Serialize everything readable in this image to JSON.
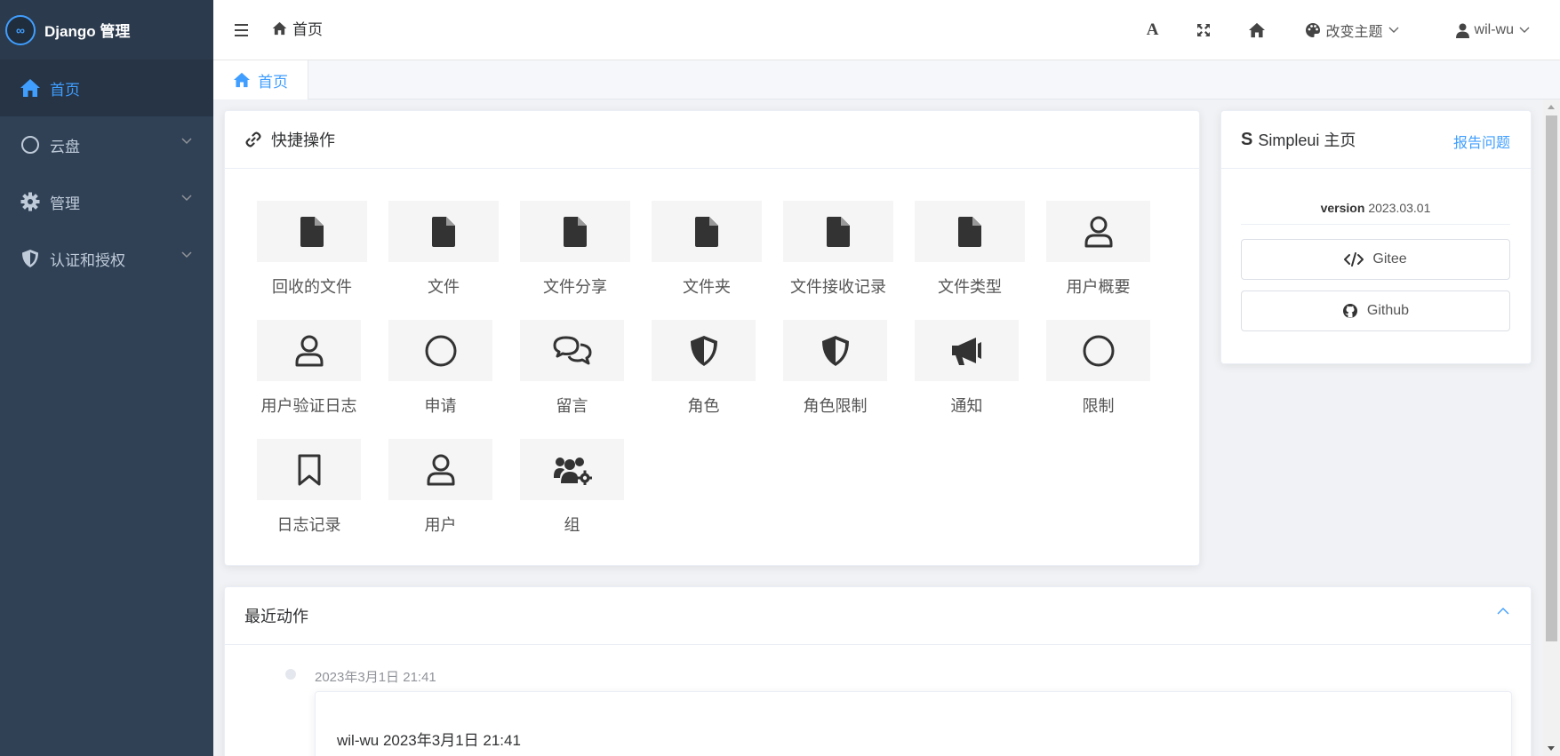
{
  "app": {
    "title": "Django 管理",
    "logo_glyph": "∞"
  },
  "sidebar": {
    "items": [
      {
        "label": "首页",
        "icon": "home-icon",
        "active": true
      },
      {
        "label": "云盘",
        "icon": "circle-icon"
      },
      {
        "label": "管理",
        "icon": "gear-icon"
      },
      {
        "label": "认证和授权",
        "icon": "shield-icon"
      }
    ]
  },
  "header": {
    "breadcrumb": "首页",
    "theme_label": "改变主题",
    "user_label": "wil-wu",
    "font_icon_glyph": "A"
  },
  "tabs": [
    {
      "label": "首页"
    }
  ],
  "quick": {
    "title": "快捷操作",
    "items": [
      {
        "label": "回收的文件",
        "icon": "file-icon"
      },
      {
        "label": "文件",
        "icon": "file-icon"
      },
      {
        "label": "文件分享",
        "icon": "file-icon"
      },
      {
        "label": "文件夹",
        "icon": "file-icon"
      },
      {
        "label": "文件接收记录",
        "icon": "file-icon"
      },
      {
        "label": "文件类型",
        "icon": "file-icon"
      },
      {
        "label": "用户概要",
        "icon": "user-icon"
      },
      {
        "label": "用户验证日志",
        "icon": "user-icon"
      },
      {
        "label": "申请",
        "icon": "circle-icon"
      },
      {
        "label": "留言",
        "icon": "comments-icon"
      },
      {
        "label": "角色",
        "icon": "shield-icon"
      },
      {
        "label": "角色限制",
        "icon": "shield-icon"
      },
      {
        "label": "通知",
        "icon": "megaphone-icon"
      },
      {
        "label": "限制",
        "icon": "circle-icon"
      },
      {
        "label": "日志记录",
        "icon": "bookmark-icon"
      },
      {
        "label": "用户",
        "icon": "user-icon"
      },
      {
        "label": "组",
        "icon": "users-gear-icon"
      }
    ]
  },
  "simpleui": {
    "logo_glyph": "S",
    "title": "Simpleui 主页",
    "report_label": "报告问题",
    "version_label": "version",
    "version_value": "2023.03.01",
    "gitee_label": "Gitee",
    "github_label": "Github"
  },
  "recent": {
    "title": "最近动作",
    "entries": [
      {
        "time": "2023年3月1日 21:41",
        "text": "wil-wu 2023年3月1日 21:41"
      }
    ]
  }
}
